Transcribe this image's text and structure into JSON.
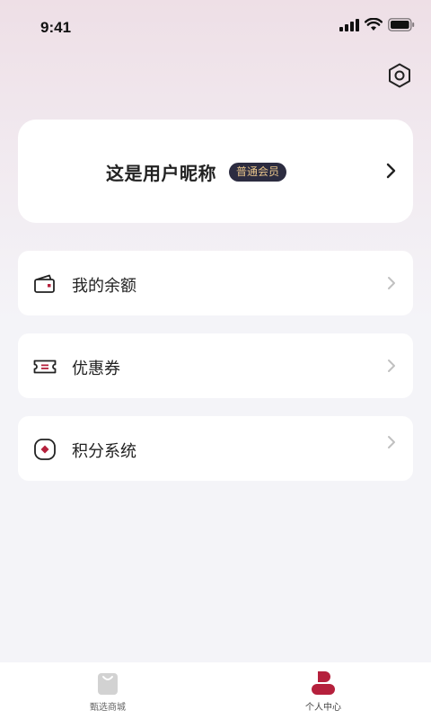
{
  "status_bar": {
    "time": "9:41"
  },
  "header": {
    "settings_icon": "hexagon-settings-icon"
  },
  "profile": {
    "nickname": "这是用户昵称",
    "member_badge": "普通会员"
  },
  "menu": [
    {
      "label": "我的余额",
      "icon": "wallet-icon"
    },
    {
      "label": "优惠券",
      "icon": "coupon-icon"
    },
    {
      "label": "积分系统",
      "icon": "points-icon"
    }
  ],
  "tab_bar": {
    "tabs": [
      {
        "label": "甄选商城",
        "icon": "shopping-bag-icon",
        "active": false
      },
      {
        "label": "个人中心",
        "icon": "user-icon",
        "active": true
      }
    ]
  },
  "colors": {
    "accent": "#b5203c",
    "badge_bg": "#2c2c40",
    "badge_text": "#e8c48a",
    "inactive_tab": "#c8c8c8"
  }
}
